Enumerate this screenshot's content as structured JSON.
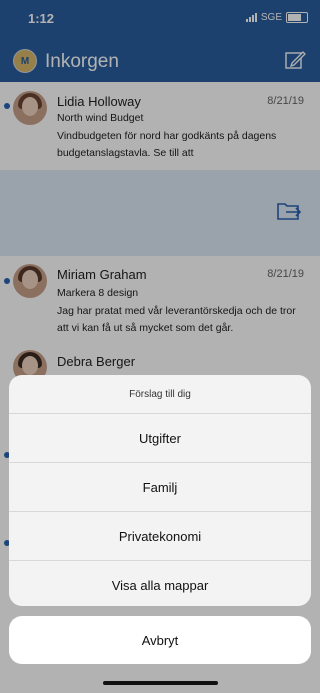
{
  "status": {
    "time": "1:12",
    "carrier": "SGE"
  },
  "header": {
    "title": "Inkorgen",
    "avatar_initial": "M"
  },
  "mails": [
    {
      "sender": "Lidia Holloway",
      "date": "8/21/19",
      "subject": "North wind Budget",
      "preview": "Vindbudgeten för nord har godkänts på dagens budgetanslagstavla. Se till att"
    },
    {
      "sender": "Miriam Graham",
      "date": "8/21/19",
      "subject": "Markera 8 design",
      "preview": "Jag har pratat med vår leverantörskedja och de tror att vi kan få ut så mycket som det går."
    },
    {
      "sender": "Debra Berger",
      "date": "",
      "subject": "",
      "preview": ""
    }
  ],
  "sheet": {
    "title": "Förslag till dig",
    "options": [
      "Utgifter",
      "Familj",
      "Privatekonomi",
      "Visa alla mappar"
    ],
    "cancel": "Avbryt"
  },
  "colors": {
    "header": "#2a5d9e",
    "unread_dot": "#2a62b0",
    "swipe_background": "#dde8f7"
  },
  "icons": {
    "compose": "compose-icon",
    "move": "move-to-folder-icon"
  }
}
